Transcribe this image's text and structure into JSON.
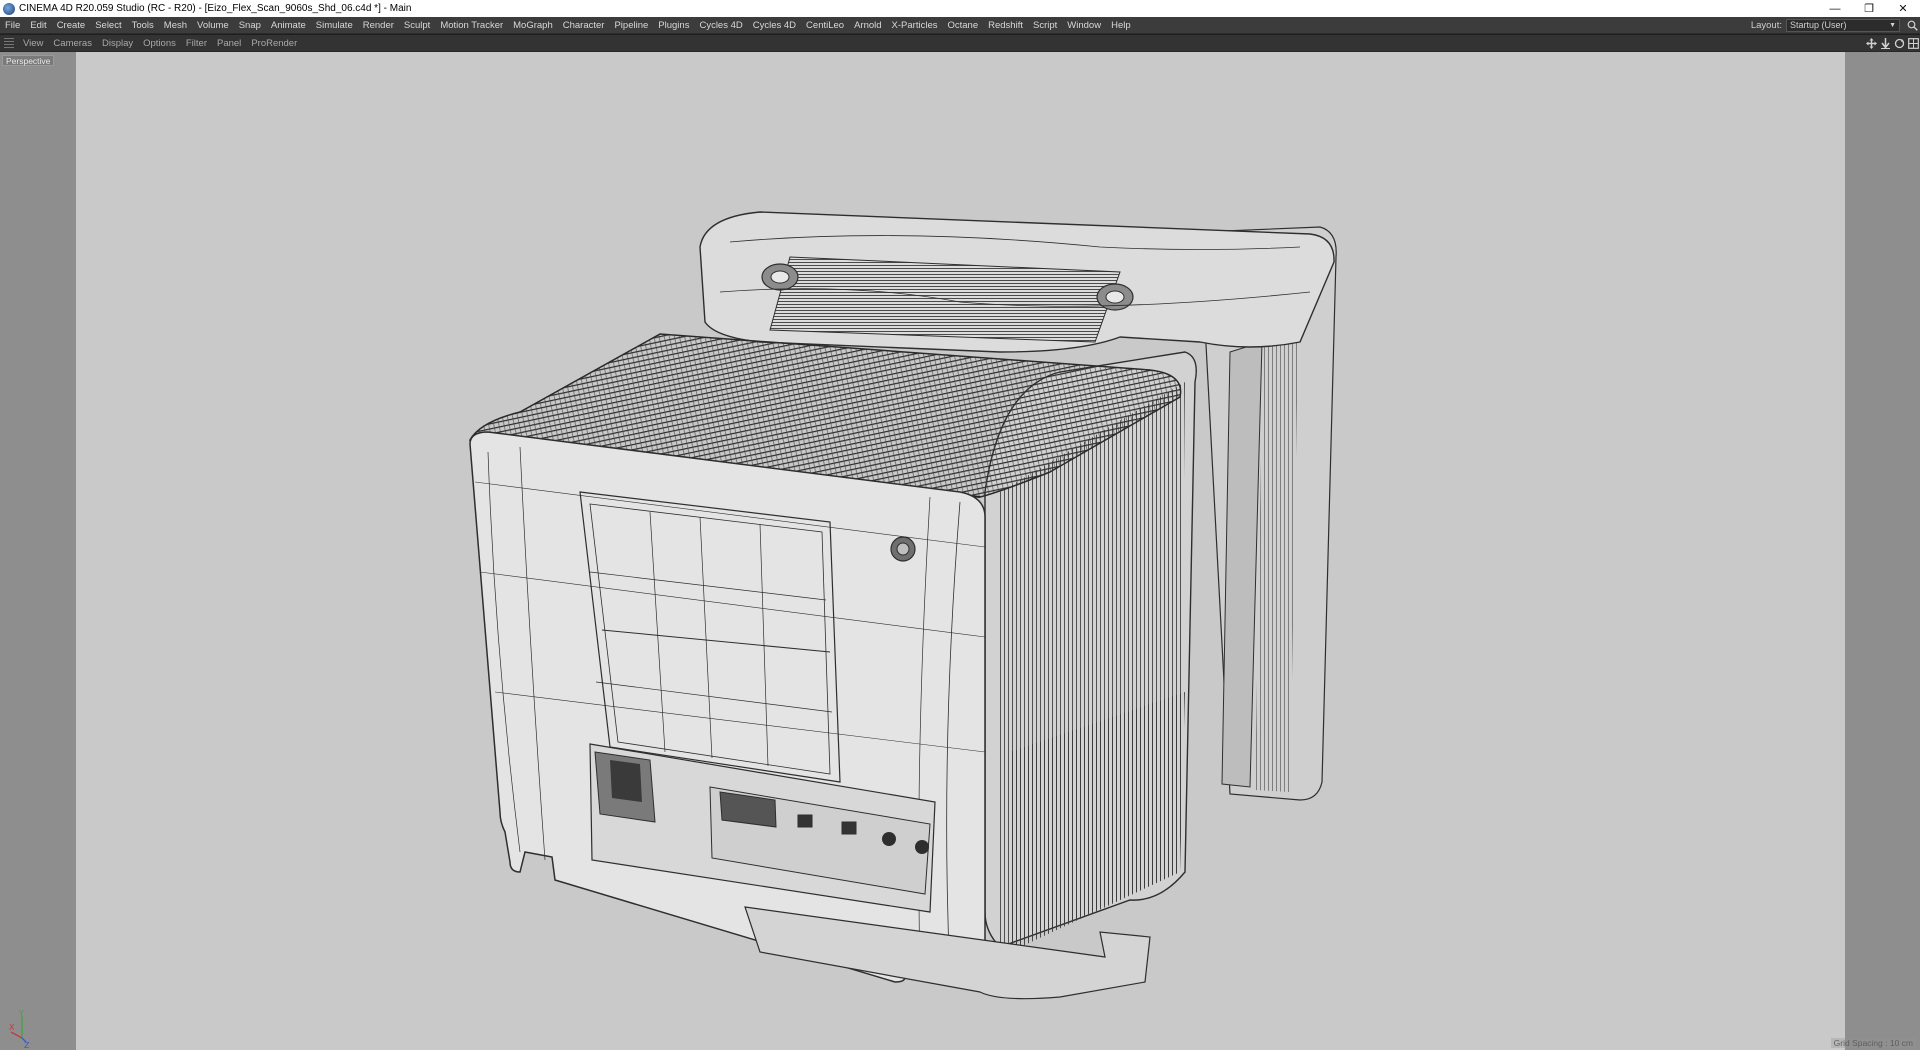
{
  "window": {
    "title": "CINEMA 4D R20.059 Studio (RC - R20) - [Eizo_Flex_Scan_9060s_Shd_06.c4d *] - Main"
  },
  "menubar": {
    "items": [
      "File",
      "Edit",
      "Create",
      "Select",
      "Tools",
      "Mesh",
      "Volume",
      "Snap",
      "Animate",
      "Simulate",
      "Render",
      "Sculpt",
      "Motion Tracker",
      "MoGraph",
      "Character",
      "Pipeline",
      "Plugins",
      "Cycles 4D",
      "Cycles 4D",
      "CentiLeo",
      "Arnold",
      "X-Particles",
      "Octane",
      "Redshift",
      "Script",
      "Window",
      "Help"
    ],
    "layout_label": "Layout:",
    "layout_value": "Startup (User)"
  },
  "viewport_menu": {
    "items": [
      "View",
      "Cameras",
      "Display",
      "Options",
      "Filter",
      "Panel",
      "ProRender"
    ]
  },
  "viewport": {
    "camera_label": "Perspective",
    "grid_spacing": "Grid Spacing : 10 cm",
    "axis_x": "X",
    "axis_y": "Y",
    "axis_z": "Z"
  },
  "colors": {
    "canvas": "#c9c9c9",
    "wire": "#2e2e2e",
    "surface": "#e4e4e4",
    "dense_wire": "#3a3a3a"
  }
}
